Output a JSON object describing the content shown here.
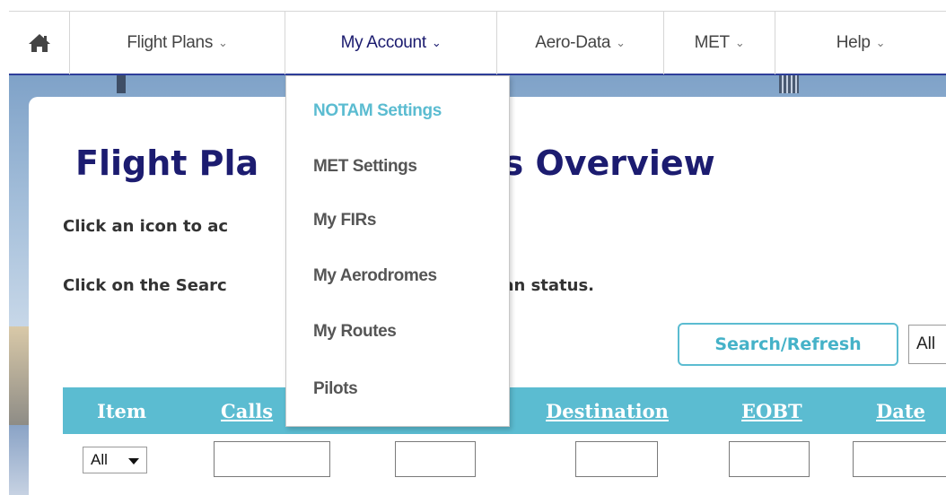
{
  "nav": {
    "home_icon": "house-icon",
    "items": [
      {
        "label": "Flight Plans",
        "chevron": "⌄"
      },
      {
        "label": "My Account",
        "chevron": "⌄"
      },
      {
        "label": "Aero-Data",
        "chevron": "⌄"
      },
      {
        "label": "MET",
        "chevron": "⌄"
      },
      {
        "label": "Help",
        "chevron": "⌄"
      }
    ],
    "active": "My Account"
  },
  "dropdown": {
    "items": [
      {
        "label": "NOTAM Settings",
        "highlighted": true
      },
      {
        "label": "MET Settings"
      },
      {
        "label": "My FIRs"
      },
      {
        "label": "My Aerodromes"
      },
      {
        "label": "My Routes"
      },
      {
        "label": "Pilots"
      }
    ]
  },
  "main": {
    "title_left": "Flight Pla",
    "title_right": "fings Overview",
    "line1": "Click an icon to ac",
    "line2_left": "Click on the Searc",
    "line2_right": "to update your Flight Plan status.",
    "search_button": "Search/Refresh",
    "status_filter": "All"
  },
  "table": {
    "headers": [
      "Item",
      "Calls",
      "Destination",
      "EOBT",
      "Date"
    ],
    "item_filter": "All"
  },
  "colors": {
    "accent": "#5bbcd1",
    "title": "#1c1c70",
    "nav_border": "#2e3e9a"
  }
}
